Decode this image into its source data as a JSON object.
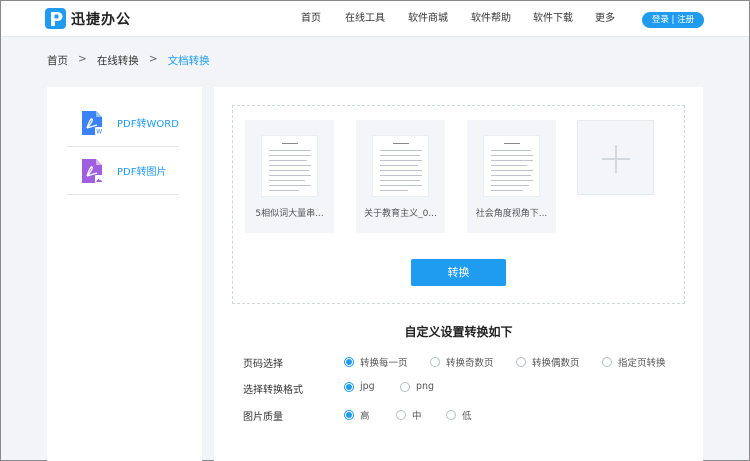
{
  "header": {
    "brand": "迅捷办公",
    "nav": [
      "首页",
      "在线工具",
      "软件商城",
      "软件帮助",
      "软件下载",
      "更多"
    ],
    "login_label": "登录 | 注册"
  },
  "breadcrumb": {
    "items": [
      "首页",
      "在线转换",
      "文档转换"
    ],
    "separator": ">"
  },
  "sidebar": {
    "items": [
      {
        "label": "PDF转WORD",
        "icon": "pdf-to-word-icon"
      },
      {
        "label": "PDF转图片",
        "icon": "pdf-to-image-icon"
      }
    ]
  },
  "files": [
    {
      "name": "5相似词大量串..."
    },
    {
      "name": "关于教育主义_0..."
    },
    {
      "name": "社会角度视角下..."
    }
  ],
  "convert_label": "转换",
  "settings": {
    "title": "自定义设置转换如下",
    "groups": [
      {
        "label": "页码选择",
        "options": [
          "转换每一页",
          "转换奇数页",
          "转换偶数页",
          "指定页转换"
        ],
        "selected": 0
      },
      {
        "label": "选择转换格式",
        "options": [
          "jpg",
          "png"
        ],
        "selected": 0
      },
      {
        "label": "图片质量",
        "options": [
          "高",
          "中",
          "低"
        ],
        "selected": 0
      }
    ]
  },
  "colors": {
    "accent": "#1f9cf0",
    "word_icon": "#3b82f6",
    "image_icon": "#a05fe0"
  }
}
